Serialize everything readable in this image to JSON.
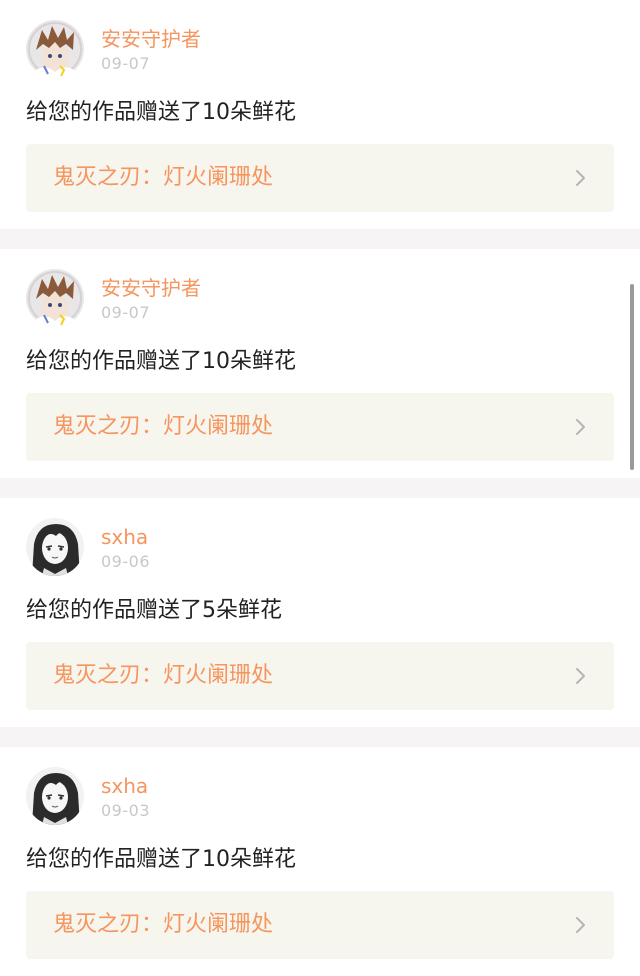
{
  "feed": {
    "items": [
      {
        "username": "安安守护者",
        "date": "09-07",
        "avatar": "avatar-anime-boy",
        "message": "给您的作品赠送了10朵鲜花",
        "work_title": "鬼灭之刃：灯火阑珊处"
      },
      {
        "username": "安安守护者",
        "date": "09-07",
        "avatar": "avatar-anime-boy",
        "message": "给您的作品赠送了10朵鲜花",
        "work_title": "鬼灭之刃：灯火阑珊处"
      },
      {
        "username": "sxha",
        "date": "09-06",
        "avatar": "avatar-manga-girl",
        "message": "给您的作品赠送了5朵鲜花",
        "work_title": "鬼灭之刃：灯火阑珊处"
      },
      {
        "username": "sxha",
        "date": "09-03",
        "avatar": "avatar-manga-girl",
        "message": "给您的作品赠送了10朵鲜花",
        "work_title": "鬼灭之刃：灯火阑珊处"
      }
    ]
  },
  "icons": {
    "chevron": "chevron-right-icon"
  },
  "colors": {
    "accent": "#f6955d",
    "date": "#c8c8c8",
    "text": "#222222",
    "link_background": "#f6f5ee",
    "separator": "#f6f4f4"
  }
}
